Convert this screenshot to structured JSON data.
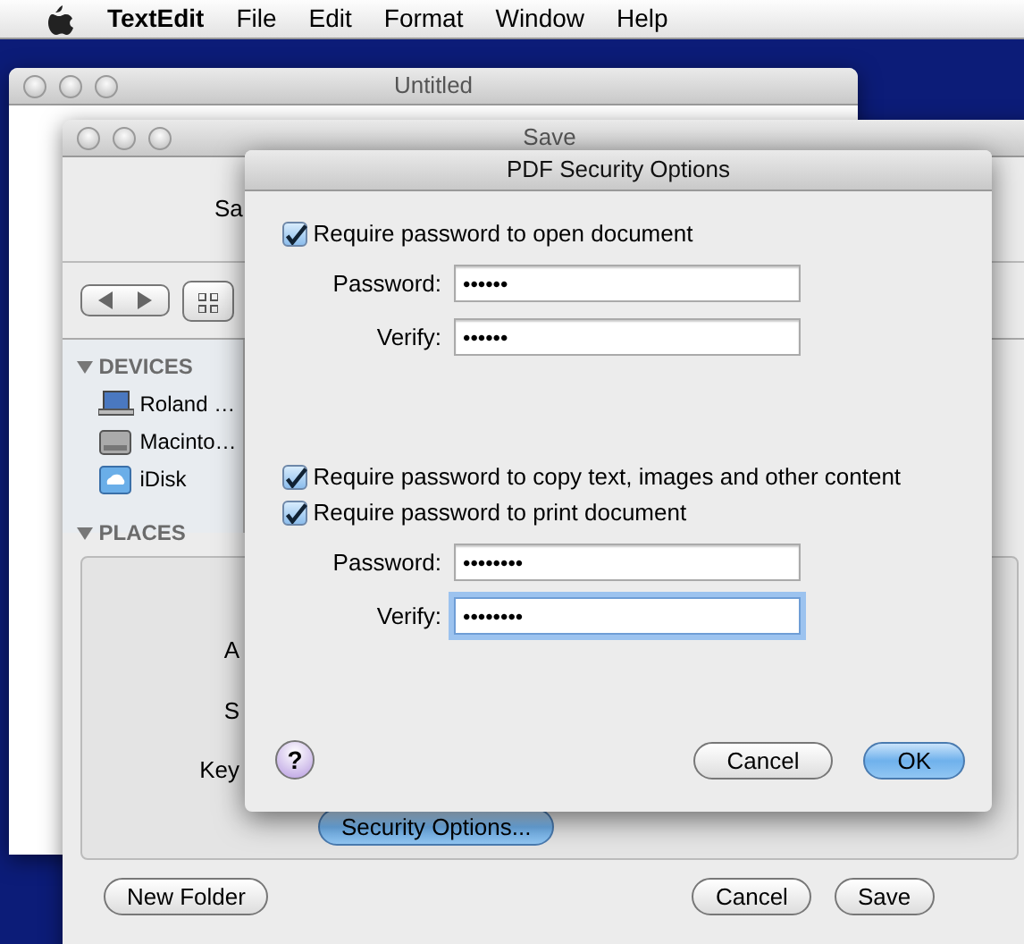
{
  "menubar": {
    "items": [
      {
        "label": "TextEdit",
        "kind": "app"
      },
      {
        "label": "File",
        "kind": "menu"
      },
      {
        "label": "Edit",
        "kind": "menu"
      },
      {
        "label": "Format",
        "kind": "menu"
      },
      {
        "label": "Window",
        "kind": "menu"
      },
      {
        "label": "Help",
        "kind": "menu"
      }
    ]
  },
  "untitled_window": {
    "title": "Untitled"
  },
  "save_window": {
    "title": "Save",
    "save_as_label": "Sa",
    "sidebar": [
      {
        "title": "DEVICES",
        "expanded": true,
        "items": [
          {
            "label": "Roland …",
            "kind": "laptop"
          },
          {
            "label": "Macinto…",
            "kind": "disk"
          },
          {
            "label": "iDisk",
            "kind": "idisk"
          }
        ]
      },
      {
        "title": "PLACES",
        "expanded": true
      }
    ],
    "field_labels": [
      "A",
      "S",
      "Key"
    ],
    "security_button": "Security Options...",
    "buttons": [
      {
        "label": "New Folder",
        "default": false
      },
      {
        "label": "Cancel",
        "default": false
      },
      {
        "label": "Save",
        "default": false
      }
    ]
  },
  "dialog": {
    "title": "PDF Security Options",
    "groups": [
      {
        "checkboxes": [
          {
            "label": "Require password to open document",
            "checked": true
          }
        ],
        "fields": [
          {
            "label": "Password:",
            "value": "••••••",
            "focused": false
          },
          {
            "label": "Verify:",
            "value": "••••••",
            "focused": false
          }
        ]
      },
      {
        "checkboxes": [
          {
            "label": "Require password to copy text, images and other content",
            "checked": true
          },
          {
            "label": "Require password to print document",
            "checked": true
          }
        ],
        "fields": [
          {
            "label": "Password:",
            "value": "••••••••",
            "focused": false
          },
          {
            "label": "Verify:",
            "value": "••••••••",
            "focused": true
          }
        ]
      }
    ],
    "help": "?",
    "buttons": [
      {
        "label": "Cancel",
        "default": false
      },
      {
        "label": "OK",
        "default": true
      }
    ]
  }
}
